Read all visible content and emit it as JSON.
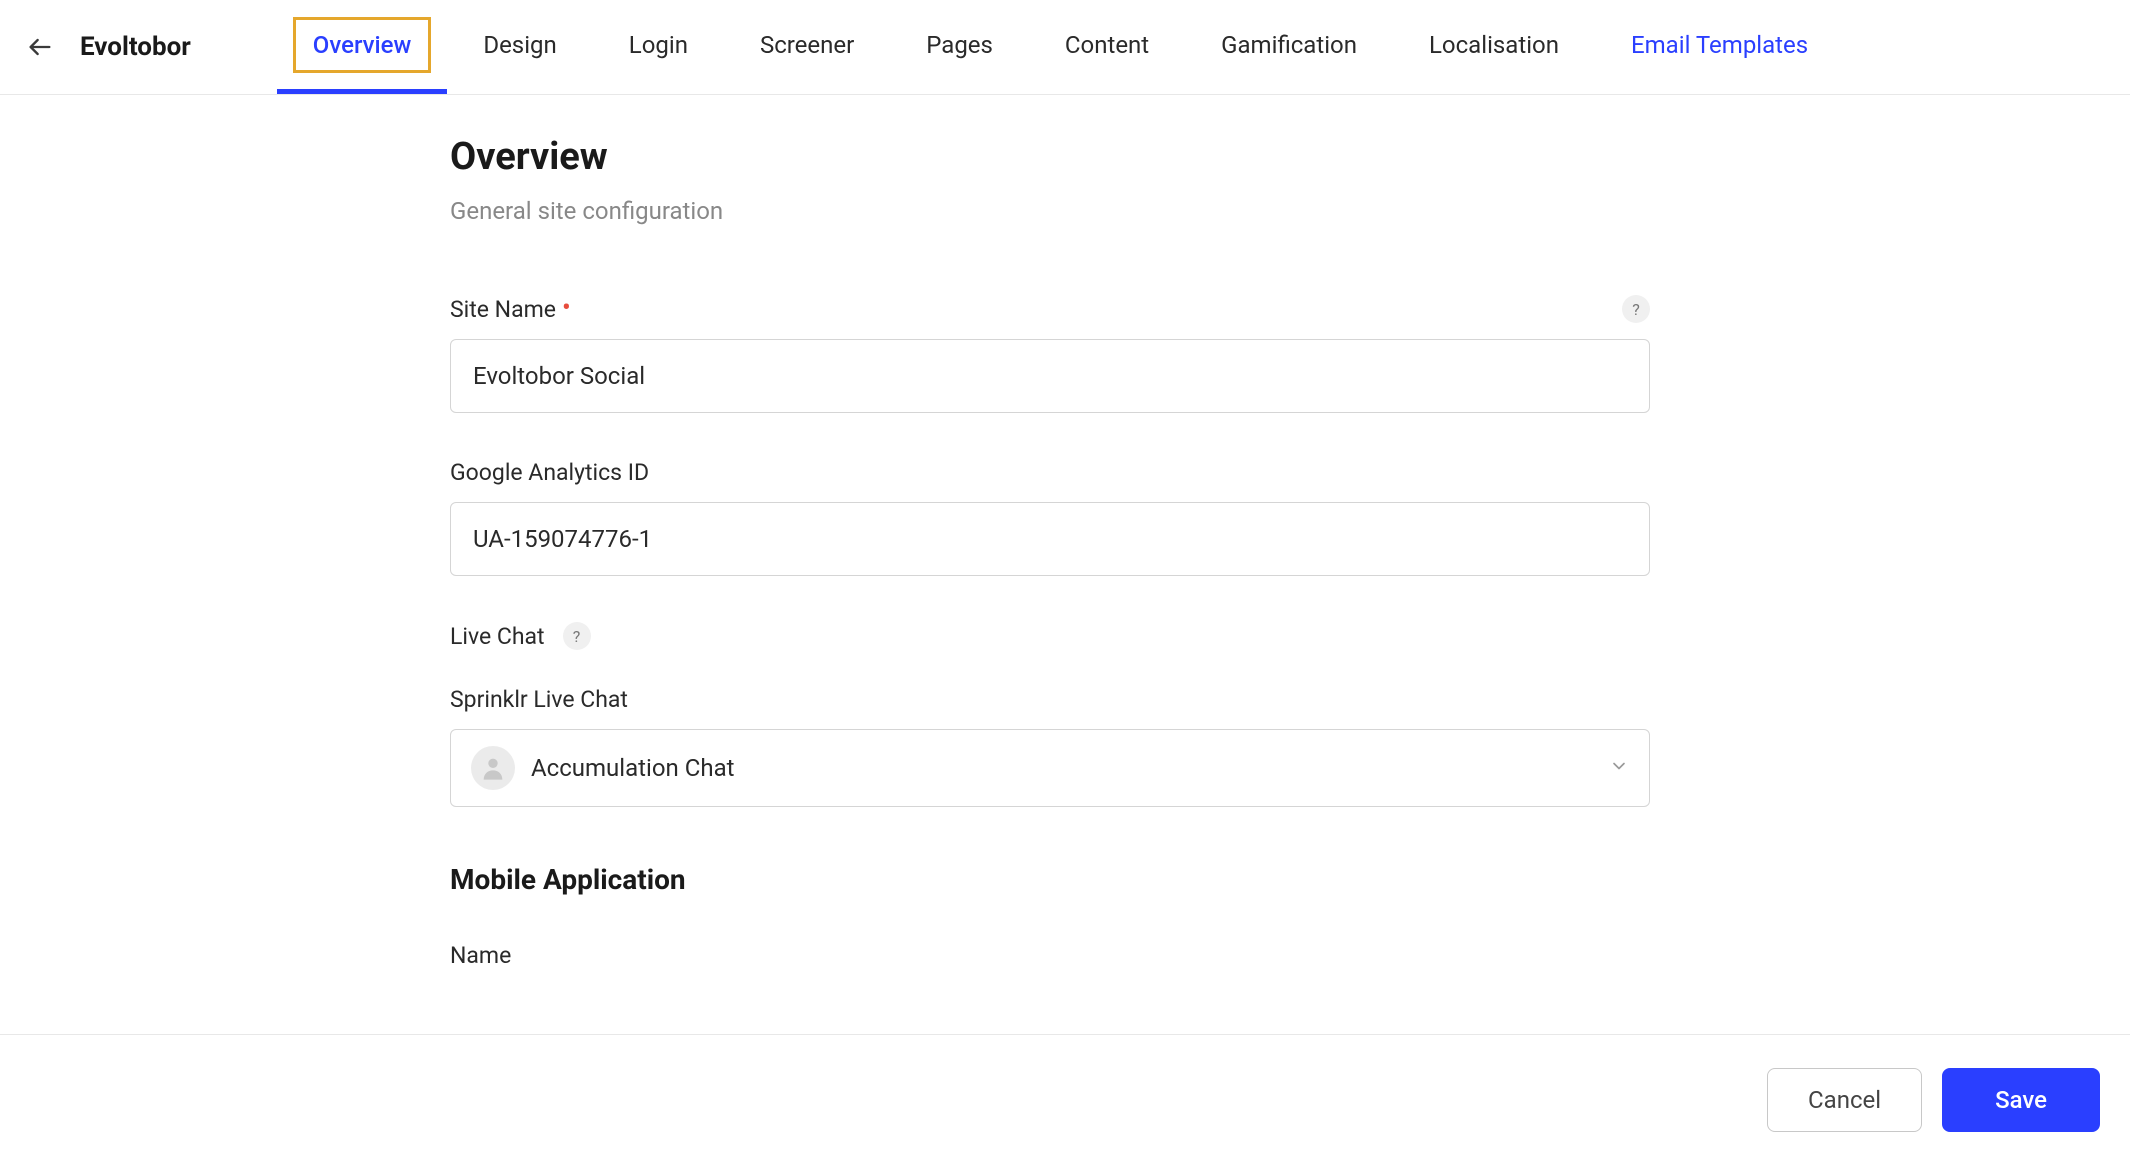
{
  "header": {
    "site_title": "Evoltobor",
    "tabs": [
      {
        "label": "Overview",
        "active": true,
        "link": false
      },
      {
        "label": "Design",
        "active": false,
        "link": false
      },
      {
        "label": "Login",
        "active": false,
        "link": false
      },
      {
        "label": "Screener",
        "active": false,
        "link": false
      },
      {
        "label": "Pages",
        "active": false,
        "link": false
      },
      {
        "label": "Content",
        "active": false,
        "link": false
      },
      {
        "label": "Gamification",
        "active": false,
        "link": false
      },
      {
        "label": "Localisation",
        "active": false,
        "link": false
      },
      {
        "label": "Email Templates",
        "active": false,
        "link": true
      }
    ]
  },
  "page": {
    "title": "Overview",
    "subtitle": "General site configuration"
  },
  "fields": {
    "site_name": {
      "label": "Site Name",
      "value": "Evoltobor Social",
      "required": true
    },
    "ga_id": {
      "label": "Google Analytics ID",
      "value": "UA-159074776-1"
    },
    "live_chat": {
      "section_label": "Live Chat",
      "label": "Sprinklr Live Chat",
      "selected": "Accumulation Chat"
    },
    "mobile_app": {
      "section_title": "Mobile Application",
      "name_label": "Name"
    }
  },
  "footer": {
    "cancel": "Cancel",
    "save": "Save"
  },
  "help_glyph": "?"
}
